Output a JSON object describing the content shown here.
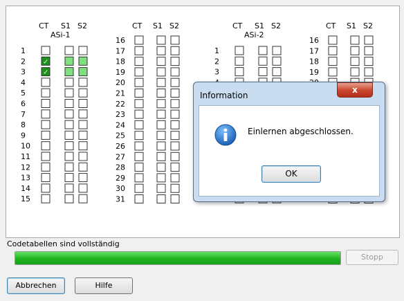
{
  "grid": {
    "headers": {
      "ct": "CT",
      "s1": "S1",
      "s2": "S2"
    },
    "group1_label": "ASi-1",
    "group2_label": "ASi-2",
    "numbers_left": [
      "1",
      "2",
      "3",
      "4",
      "5",
      "6",
      "7",
      "8",
      "9",
      "10",
      "11",
      "12",
      "13",
      "14",
      "15"
    ],
    "numbers_right": [
      "16",
      "17",
      "18",
      "19",
      "20",
      "21",
      "22",
      "23",
      "24",
      "25",
      "26",
      "27",
      "28",
      "29",
      "30",
      "31"
    ],
    "checked_ct_rows_group1": [
      "2",
      "3"
    ],
    "lit_s_rows_group1": [
      "2",
      "3"
    ],
    "checkmark": "✓"
  },
  "status_text": "Codetabellen sind vollständig",
  "progress": {
    "percent": 100,
    "color": "#1fb31f"
  },
  "buttons": {
    "stop": "Stopp",
    "cancel": "Abbrechen",
    "help": "Hilfe"
  },
  "dialog": {
    "title": "Information",
    "close_label": "x",
    "message": "Einlernen abgeschlossen.",
    "ok": "OK",
    "icon": "info-icon"
  }
}
